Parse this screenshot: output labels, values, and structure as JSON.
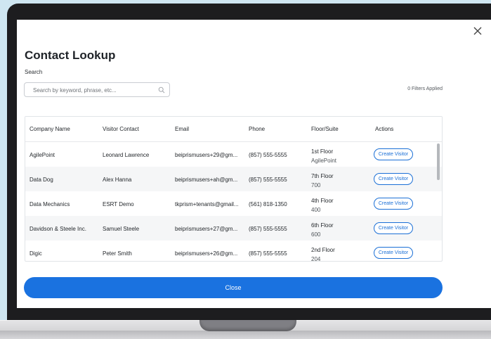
{
  "modal": {
    "title": "Contact Lookup",
    "search_label": "Search",
    "search_placeholder": "Search by keyword, phrase, etc...",
    "search_value": "",
    "filters_applied": "0 Filters Applied",
    "close_button_label": "Close"
  },
  "table": {
    "columns": [
      "Company Name",
      "Visitor Contact",
      "Email",
      "Phone",
      "Floor/Suite",
      "Actions"
    ],
    "rows": [
      {
        "company": "AgilePoint",
        "contact": "Leonard Lawrence",
        "email": "beiprismusers+29@gm...",
        "phone": "(857) 555-5555",
        "floor": "1st Floor",
        "suite": "AgilePoint",
        "action": "Create Visitor"
      },
      {
        "company": "Data Dog",
        "contact": "Alex Hanna",
        "email": "beiprismusers+ah@gm...",
        "phone": "(857) 555-5555",
        "floor": "7th Floor",
        "suite": "700",
        "action": "Create Visitor"
      },
      {
        "company": "Data Mechanics",
        "contact": "ESRT Demo",
        "email": "tkprism+tenants@gmail...",
        "phone": "(561) 818-1350",
        "floor": "4th Floor",
        "suite": "400",
        "action": "Create Visitor"
      },
      {
        "company": "Davidson & Steele Inc.",
        "contact": "Samuel Steele",
        "email": "beiprismusers+27@gm...",
        "phone": "(857) 555-5555",
        "floor": "6th Floor",
        "suite": "600",
        "action": "Create Visitor"
      },
      {
        "company": "Digic",
        "contact": "Peter Smith",
        "email": "beiprismusers+26@gm...",
        "phone": "(857) 555-5555",
        "floor": "2nd Floor",
        "suite": "204",
        "action": "Create Visitor"
      }
    ]
  },
  "icons": {
    "close": "close-icon",
    "search": "search-icon"
  },
  "colors": {
    "accent": "#1a72e0",
    "background": "#cfe6f1"
  }
}
